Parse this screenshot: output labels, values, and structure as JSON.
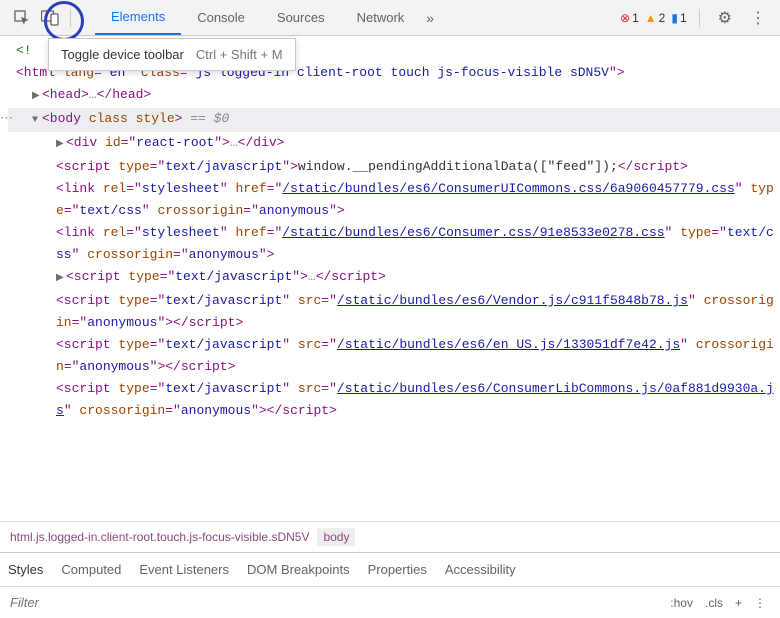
{
  "toolbar": {
    "tabs": [
      "Elements",
      "Console",
      "Sources",
      "Network"
    ],
    "activeTab": "Elements",
    "errors": "1",
    "warnings": "2",
    "messages": "1"
  },
  "tooltip": {
    "label": "Toggle device toolbar",
    "shortcut": "Ctrl + Shift + M"
  },
  "dom": {
    "doctype_prefix": "<!",
    "html_open": "<html lang=\"en\" class=\"js logged-in client-root touch js-focus-visible sDN5V\">",
    "head_open": "<head>",
    "head_close": "</head>",
    "body_open": "<body class style>",
    "eq0": " == $0",
    "react_div": "<div id=\"react-root\">",
    "react_close": "</div>",
    "script_inline_open": "<script type=\"text/javascript\">",
    "script_inline_content": "window.__pendingAdditionalData([\"feed\"]);",
    "script_close": "</script>",
    "link1_pre": "<link rel=\"stylesheet\" href=\"",
    "link1_url": "/static/bundles/es6/ConsumerUICommons.css/6a9060457779.css",
    "link1_post": "\" type=\"text/css\" crossorigin=\"anonymous\">",
    "link2_pre": "<link rel=\"stylesheet\" href=\"",
    "link2_url": "/static/bundles/es6/Consumer.css/91e8533e0278.css",
    "link2_post": "\" type=\"text/css\" crossorigin=\"anonymous\">",
    "script_collapsed_open": "<script type=\"text/javascript\">",
    "script3_pre": "<script type=\"text/javascript\" src=\"",
    "script3_url": "/static/bundles/es6/Vendor.js/c911f5848b78.js",
    "script3_post": "\" crossorigin=\"anonymous\">",
    "script4_pre": "<script type=\"text/javascript\" src=\"",
    "script4_url": "/static/bundles/es6/en_US.js/133051df7e42.js",
    "script4_post": "\" crossorigin=\"anonymous\">",
    "script5_pre": "<script type=\"text/javascript\" src=\"",
    "script5_url": "/static/bundles/es6/ConsumerLibCommons.js/0af881d9930a.js",
    "script5_post": "\" crossorigin=\"anonymous\">"
  },
  "breadcrumb": {
    "path": "html.js.logged-in.client-root.touch.js-focus-visible.sDN5V",
    "current": "body"
  },
  "stylesTabs": [
    "Styles",
    "Computed",
    "Event Listeners",
    "DOM Breakpoints",
    "Properties",
    "Accessibility"
  ],
  "stylesActive": "Styles",
  "filter": {
    "placeholder": "Filter",
    "hov": ":hov",
    "cls": ".cls",
    "plus": "+"
  }
}
